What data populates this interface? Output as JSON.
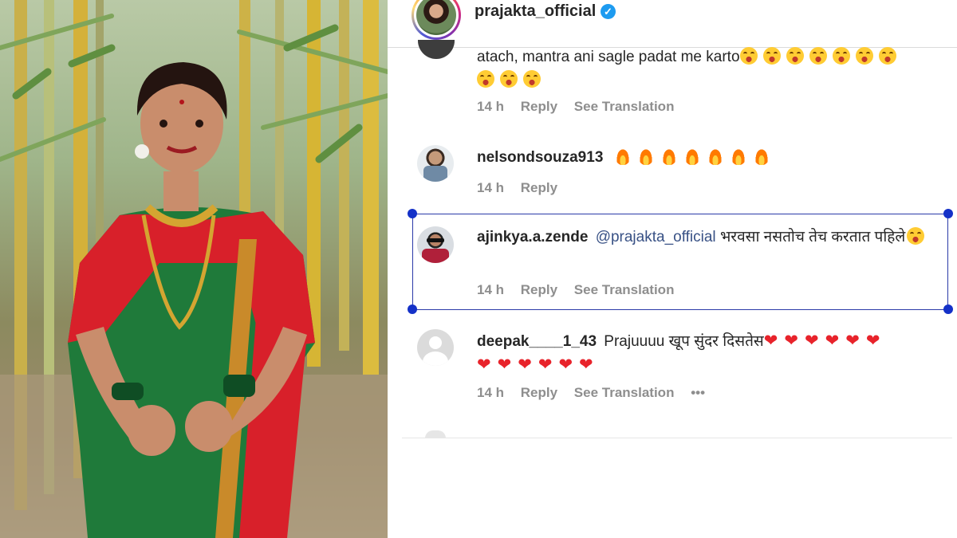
{
  "post": {
    "username": "prajakta_official",
    "verified_mark": "✓"
  },
  "comments": [
    {
      "text": "atach, mantra ani sagle padat me karto",
      "emoji": "laughing-emoji",
      "time": "14 h",
      "reply": "Reply",
      "translation": "See Translation"
    },
    {
      "username": "nelsondsouza913",
      "emoji": "fire-emoji",
      "time": "14 h",
      "reply": "Reply"
    },
    {
      "username": "ajinkya.a.zende",
      "mention": "@prajakta_official",
      "text": "भरवसा नसतोच तेच करतात पहिले",
      "time": "14 h",
      "reply": "Reply",
      "translation": "See Translation"
    },
    {
      "username": "deepak____1_43",
      "text": "Prajuuuu खूप सुंदर दिसतेस",
      "heart": "❤",
      "time": "14 h",
      "reply": "Reply",
      "translation": "See Translation",
      "more": "•••"
    }
  ],
  "colors": {
    "selection": "#2a3aa8",
    "handle": "#1431c8",
    "verified": "#1d9bf0",
    "mention": "#385185",
    "meta": "#8e8e8e"
  }
}
